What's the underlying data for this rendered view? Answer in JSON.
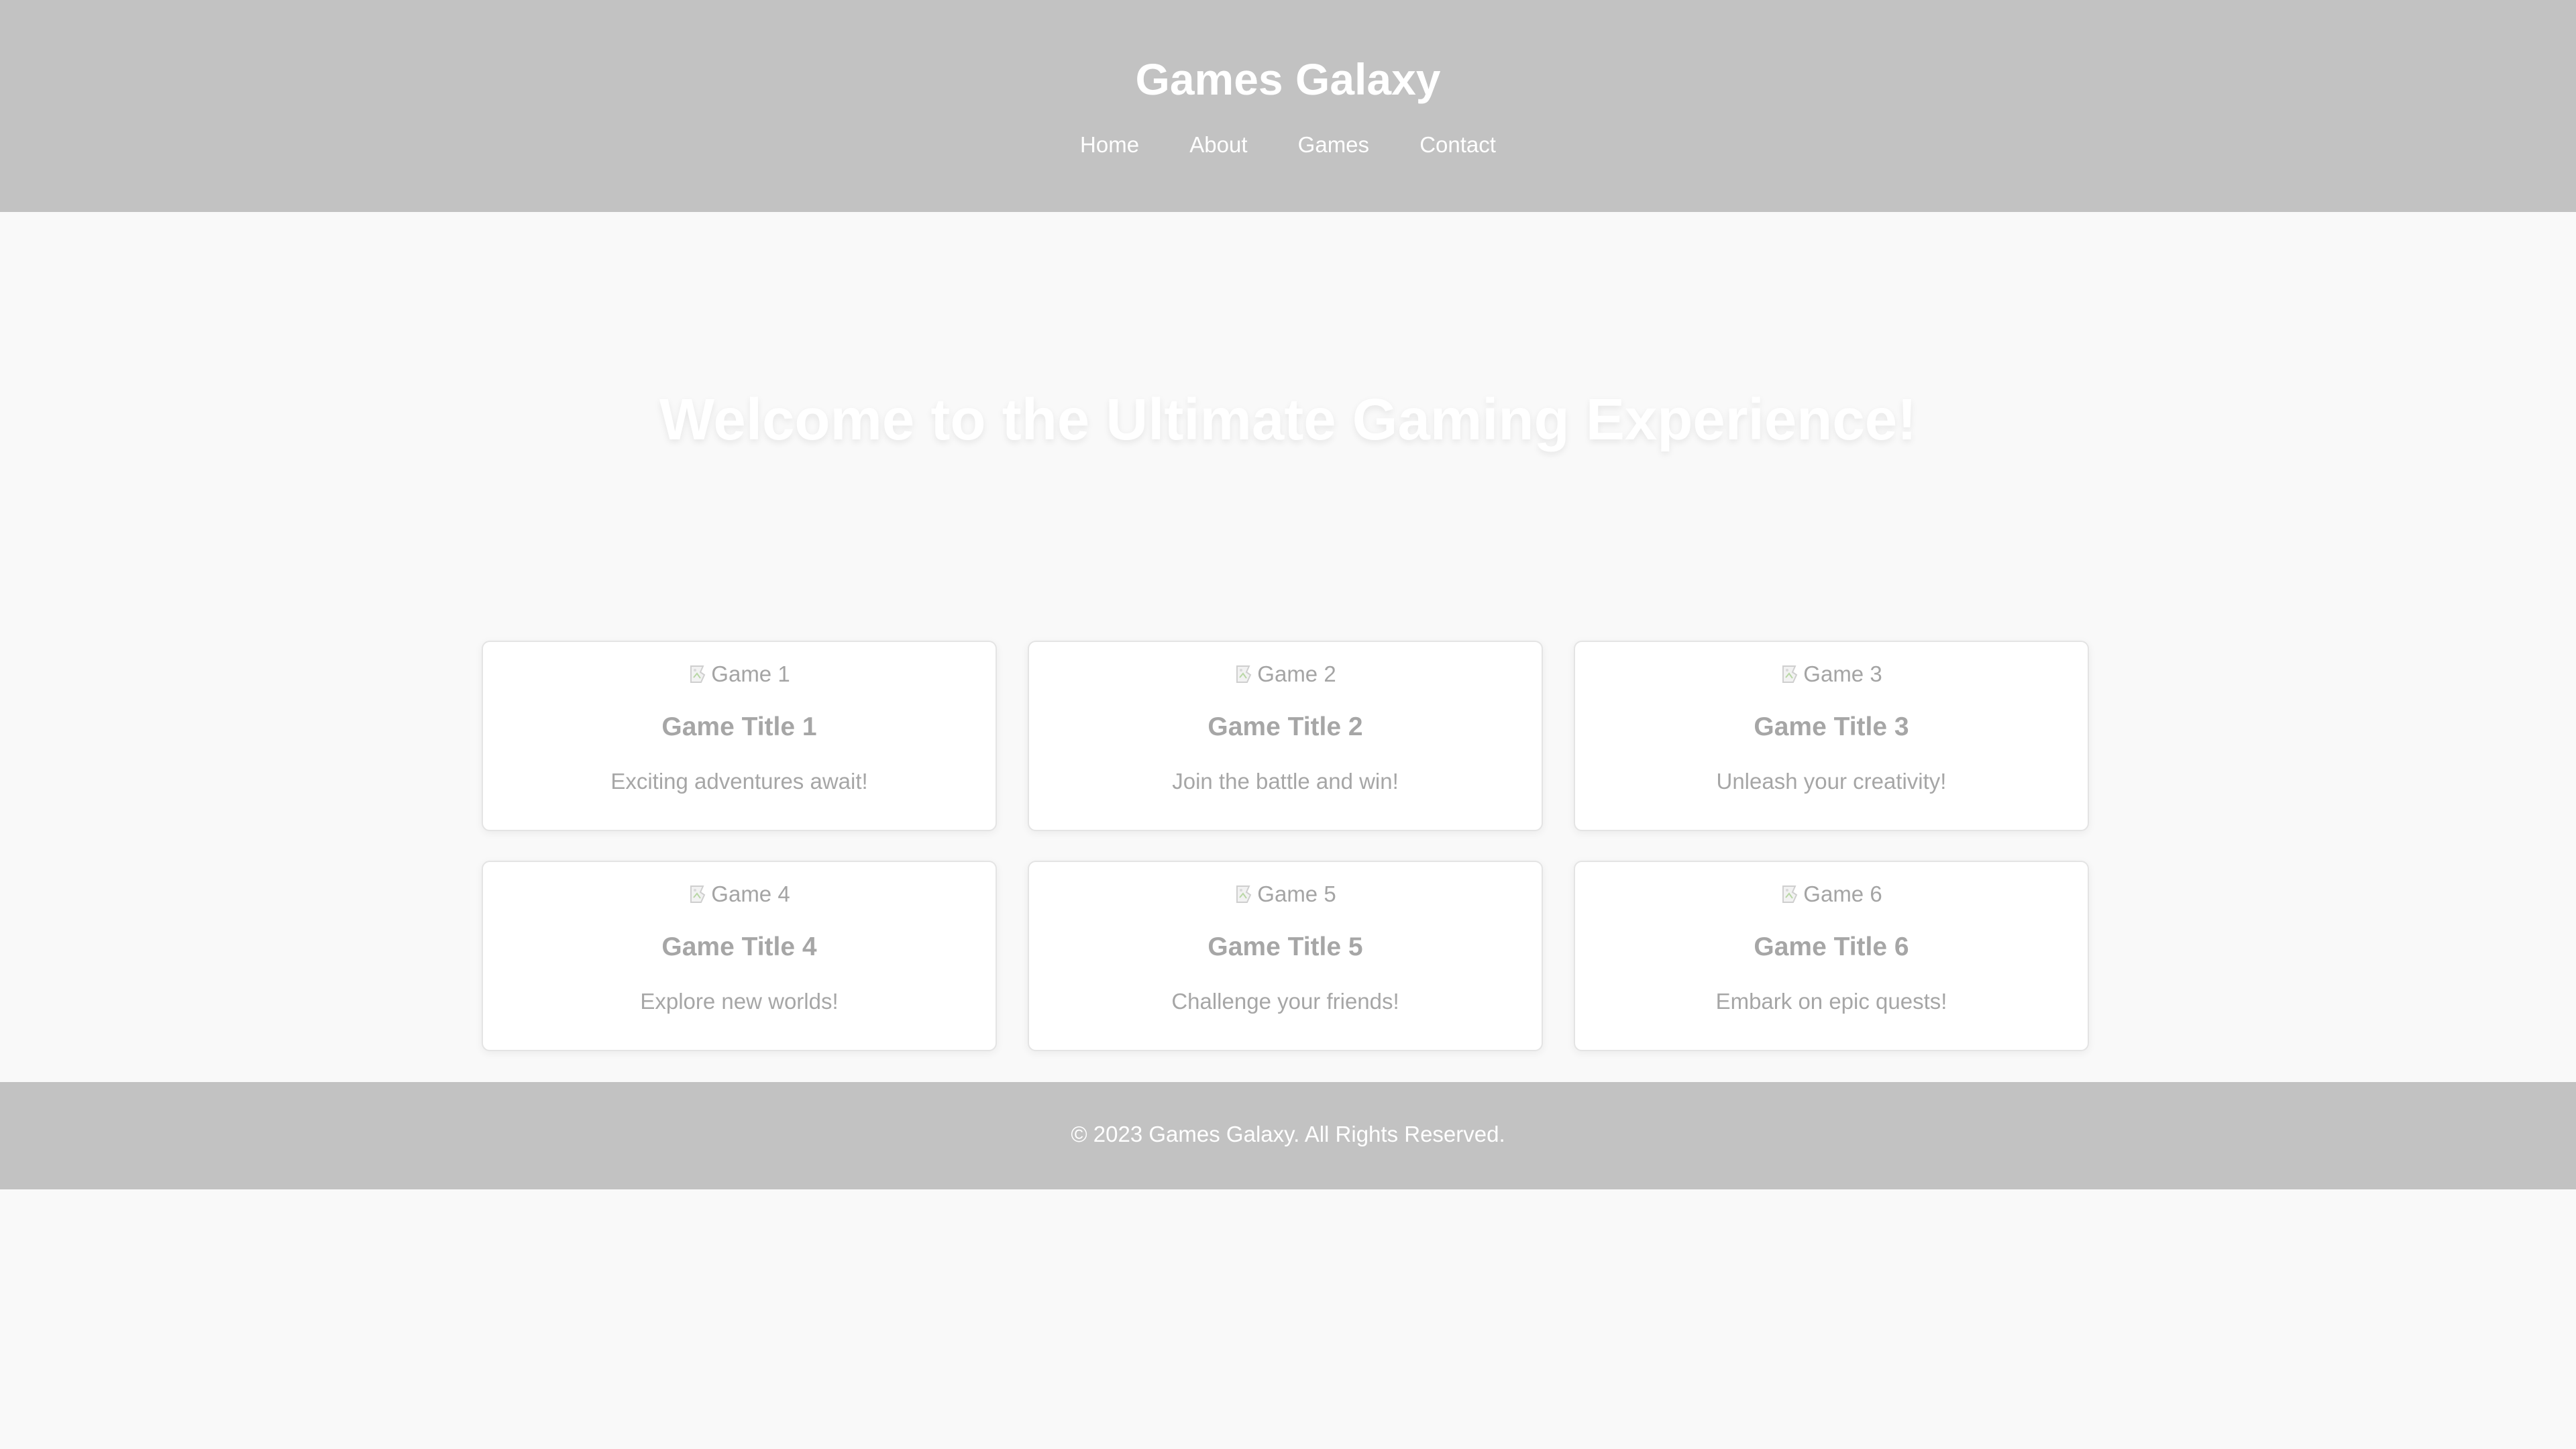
{
  "header": {
    "title": "Games Galaxy",
    "nav": [
      "Home",
      "About",
      "Games",
      "Contact"
    ]
  },
  "hero": {
    "title": "Welcome to the Ultimate Gaming Experience!"
  },
  "games": [
    {
      "image_alt": "Game 1",
      "title": "Game Title 1",
      "description": "Exciting adventures await!"
    },
    {
      "image_alt": "Game 2",
      "title": "Game Title 2",
      "description": "Join the battle and win!"
    },
    {
      "image_alt": "Game 3",
      "title": "Game Title 3",
      "description": "Unleash your creativity!"
    },
    {
      "image_alt": "Game 4",
      "title": "Game Title 4",
      "description": "Explore new worlds!"
    },
    {
      "image_alt": "Game 5",
      "title": "Game Title 5",
      "description": "Challenge your friends!"
    },
    {
      "image_alt": "Game 6",
      "title": "Game Title 6",
      "description": "Embark on epic quests!"
    }
  ],
  "footer": {
    "text": "© 2023 Games Galaxy. All Rights Reserved."
  },
  "colors": {
    "header_bg": "#c2c2c2",
    "page_bg": "#f9f9f9",
    "card_bg": "#ffffff",
    "muted_text": "#a6a6a6",
    "header_text": "#ffffff"
  }
}
